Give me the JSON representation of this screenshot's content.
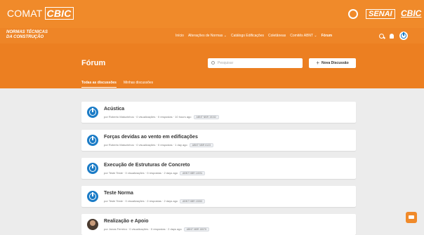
{
  "header": {
    "brand_prefix": "COMAT",
    "brand_suffix": "CBIC",
    "partner_1": "SENAI",
    "partner_2": "CBIC"
  },
  "nav": {
    "site_line1": "NORMAS TÉCNICAS",
    "site_line2": "DA CONSTRUÇÃO",
    "links": [
      {
        "label": "Início"
      },
      {
        "label": "Alterações de Normas ⌄"
      },
      {
        "label": "Catálogo Edificações"
      },
      {
        "label": "Coletâneas"
      },
      {
        "label": "Comitês ABNT ⌄"
      },
      {
        "label": "Fórum"
      }
    ]
  },
  "forum": {
    "title": "Fórum",
    "search_placeholder": "Pesquisar",
    "new_button": "Nova Discussão",
    "tabs": [
      "Todas as discussões",
      "Minhas discussões"
    ]
  },
  "discussions": [
    {
      "title": "Acústica",
      "meta": "por Roberto Matozinhos · 0 visualizações · 0 respostas · 10 hours ago",
      "tag": "ABNT NBR 15152"
    },
    {
      "title": "Forças devidas ao vento em edificações",
      "meta": "por Roberto Matozinhos · 0 visualizações · 0 respostas · 1 day ago",
      "tag": "ABNT NBR 6123"
    },
    {
      "title": "Execução de Estruturas de Concreto",
      "meta": "por Teste Teste · 0 visualizações · 0 respostas · 2 days ago",
      "tag": "ABNT NBR 14931"
    },
    {
      "title": "Teste Norma",
      "meta": "por Teste Teste · 0 visualizações · 2 respostas · 2 days ago",
      "tag": "ABNT NBR 15352"
    },
    {
      "title": "Realização e Apoio",
      "meta": "por Jonas Ferreira · 0 visualizações · 0 respostas · 2 days ago",
      "tag": "ABNT NBR 15575"
    }
  ],
  "colors": {
    "primary": "#f08a2a",
    "accent": "#1a7bc6"
  }
}
